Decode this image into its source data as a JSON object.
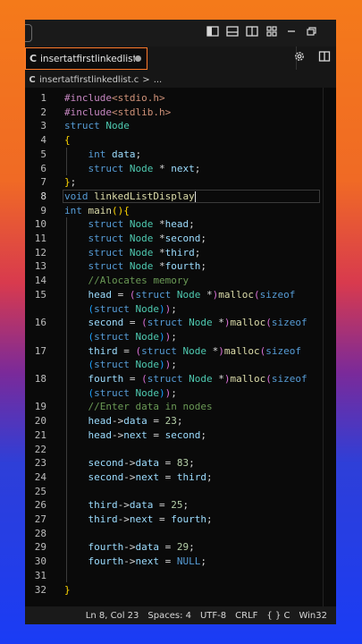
{
  "titlebar": {
    "icons": [
      "layout-sidebar-left-icon",
      "layout-panel-icon",
      "layout-sidebar-right-icon",
      "customize-layout-icon",
      "minimize-icon",
      "restore-icon"
    ]
  },
  "tab": {
    "icon": "C",
    "label": "insertatfirstlinkedlist.c",
    "dirty": true
  },
  "breadcrumb": {
    "icon": "C",
    "file": "insertatfirstlinkedlist.c",
    "sep": ">",
    "rest": "..."
  },
  "editor": {
    "active_line": 8,
    "lines": [
      {
        "n": "1",
        "tokens": [
          [
            "pp",
            "#include"
          ],
          [
            "inc",
            "<stdio.h>"
          ]
        ]
      },
      {
        "n": "2",
        "tokens": [
          [
            "pp",
            "#include"
          ],
          [
            "inc",
            "<stdlib.h>"
          ]
        ]
      },
      {
        "n": "3",
        "tokens": [
          [
            "kw",
            "struct"
          ],
          [
            "plain",
            " "
          ],
          [
            "type",
            "Node"
          ]
        ]
      },
      {
        "n": "4",
        "tokens": [
          [
            "br1",
            "{"
          ]
        ]
      },
      {
        "n": "5",
        "tokens": [
          [
            "plain",
            "    "
          ],
          [
            "kw",
            "int"
          ],
          [
            "plain",
            " "
          ],
          [
            "var",
            "data"
          ],
          [
            "plain",
            ";"
          ]
        ]
      },
      {
        "n": "6",
        "tokens": [
          [
            "plain",
            "    "
          ],
          [
            "kw",
            "struct"
          ],
          [
            "plain",
            " "
          ],
          [
            "type",
            "Node"
          ],
          [
            "plain",
            " * "
          ],
          [
            "var",
            "next"
          ],
          [
            "plain",
            ";"
          ]
        ]
      },
      {
        "n": "7",
        "tokens": [
          [
            "br1",
            "}"
          ],
          [
            "plain",
            ";"
          ]
        ]
      },
      {
        "n": "8",
        "tokens": [
          [
            "kw",
            "void"
          ],
          [
            "plain",
            " "
          ],
          [
            "fn",
            "linkedListDisplay"
          ]
        ]
      },
      {
        "n": "9",
        "tokens": [
          [
            "kw",
            "int"
          ],
          [
            "plain",
            " "
          ],
          [
            "fn",
            "main"
          ],
          [
            "br1",
            "()"
          ],
          [
            "br1",
            "{"
          ]
        ]
      },
      {
        "n": "10",
        "tokens": [
          [
            "plain",
            "    "
          ],
          [
            "kw",
            "struct"
          ],
          [
            "plain",
            " "
          ],
          [
            "type",
            "Node"
          ],
          [
            "plain",
            " *"
          ],
          [
            "var",
            "head"
          ],
          [
            "plain",
            ";"
          ]
        ]
      },
      {
        "n": "11",
        "tokens": [
          [
            "plain",
            "    "
          ],
          [
            "kw",
            "struct"
          ],
          [
            "plain",
            " "
          ],
          [
            "type",
            "Node"
          ],
          [
            "plain",
            " *"
          ],
          [
            "var",
            "second"
          ],
          [
            "plain",
            ";"
          ]
        ]
      },
      {
        "n": "12",
        "tokens": [
          [
            "plain",
            "    "
          ],
          [
            "kw",
            "struct"
          ],
          [
            "plain",
            " "
          ],
          [
            "type",
            "Node"
          ],
          [
            "plain",
            " *"
          ],
          [
            "var",
            "third"
          ],
          [
            "plain",
            ";"
          ]
        ]
      },
      {
        "n": "13",
        "tokens": [
          [
            "plain",
            "    "
          ],
          [
            "kw",
            "struct"
          ],
          [
            "plain",
            " "
          ],
          [
            "type",
            "Node"
          ],
          [
            "plain",
            " *"
          ],
          [
            "var",
            "fourth"
          ],
          [
            "plain",
            ";"
          ]
        ]
      },
      {
        "n": "14",
        "tokens": [
          [
            "plain",
            "    "
          ],
          [
            "com",
            "//Alocates memory"
          ]
        ]
      },
      {
        "n": "15",
        "tokens": [
          [
            "plain",
            "    "
          ],
          [
            "var",
            "head"
          ],
          [
            "plain",
            " = "
          ],
          [
            "br2",
            "("
          ],
          [
            "kw",
            "struct"
          ],
          [
            "plain",
            " "
          ],
          [
            "type",
            "Node"
          ],
          [
            "plain",
            " *"
          ],
          [
            "br2",
            ")"
          ],
          [
            "fn",
            "malloc"
          ],
          [
            "br2",
            "("
          ],
          [
            "kw",
            "sizeof"
          ]
        ]
      },
      {
        "n": "",
        "tokens": [
          [
            "plain",
            "    "
          ],
          [
            "br3",
            "("
          ],
          [
            "kw",
            "struct"
          ],
          [
            "plain",
            " "
          ],
          [
            "type",
            "Node"
          ],
          [
            "br3",
            ")"
          ],
          [
            "br2",
            ")"
          ],
          [
            "plain",
            ";"
          ]
        ]
      },
      {
        "n": "16",
        "tokens": [
          [
            "plain",
            "    "
          ],
          [
            "var",
            "second"
          ],
          [
            "plain",
            " = "
          ],
          [
            "br2",
            "("
          ],
          [
            "kw",
            "struct"
          ],
          [
            "plain",
            " "
          ],
          [
            "type",
            "Node"
          ],
          [
            "plain",
            " *"
          ],
          [
            "br2",
            ")"
          ],
          [
            "fn",
            "malloc"
          ],
          [
            "br2",
            "("
          ],
          [
            "kw",
            "sizeof"
          ]
        ]
      },
      {
        "n": "",
        "tokens": [
          [
            "plain",
            "    "
          ],
          [
            "br3",
            "("
          ],
          [
            "kw",
            "struct"
          ],
          [
            "plain",
            " "
          ],
          [
            "type",
            "Node"
          ],
          [
            "br3",
            ")"
          ],
          [
            "br2",
            ")"
          ],
          [
            "plain",
            ";"
          ]
        ]
      },
      {
        "n": "17",
        "tokens": [
          [
            "plain",
            "    "
          ],
          [
            "var",
            "third"
          ],
          [
            "plain",
            " = "
          ],
          [
            "br2",
            "("
          ],
          [
            "kw",
            "struct"
          ],
          [
            "plain",
            " "
          ],
          [
            "type",
            "Node"
          ],
          [
            "plain",
            " *"
          ],
          [
            "br2",
            ")"
          ],
          [
            "fn",
            "malloc"
          ],
          [
            "br2",
            "("
          ],
          [
            "kw",
            "sizeof"
          ]
        ]
      },
      {
        "n": "",
        "tokens": [
          [
            "plain",
            "    "
          ],
          [
            "br3",
            "("
          ],
          [
            "kw",
            "struct"
          ],
          [
            "plain",
            " "
          ],
          [
            "type",
            "Node"
          ],
          [
            "br3",
            ")"
          ],
          [
            "br2",
            ")"
          ],
          [
            "plain",
            ";"
          ]
        ]
      },
      {
        "n": "18",
        "tokens": [
          [
            "plain",
            "    "
          ],
          [
            "var",
            "fourth"
          ],
          [
            "plain",
            " = "
          ],
          [
            "br2",
            "("
          ],
          [
            "kw",
            "struct"
          ],
          [
            "plain",
            " "
          ],
          [
            "type",
            "Node"
          ],
          [
            "plain",
            " *"
          ],
          [
            "br2",
            ")"
          ],
          [
            "fn",
            "malloc"
          ],
          [
            "br2",
            "("
          ],
          [
            "kw",
            "sizeof"
          ]
        ]
      },
      {
        "n": "",
        "tokens": [
          [
            "plain",
            "    "
          ],
          [
            "br3",
            "("
          ],
          [
            "kw",
            "struct"
          ],
          [
            "plain",
            " "
          ],
          [
            "type",
            "Node"
          ],
          [
            "br3",
            ")"
          ],
          [
            "br2",
            ")"
          ],
          [
            "plain",
            ";"
          ]
        ]
      },
      {
        "n": "19",
        "tokens": [
          [
            "plain",
            "    "
          ],
          [
            "com",
            "//Enter data in nodes"
          ]
        ]
      },
      {
        "n": "20",
        "tokens": [
          [
            "plain",
            "    "
          ],
          [
            "var",
            "head"
          ],
          [
            "plain",
            "->"
          ],
          [
            "var",
            "data"
          ],
          [
            "plain",
            " = "
          ],
          [
            "num",
            "23"
          ],
          [
            "plain",
            ";"
          ]
        ]
      },
      {
        "n": "21",
        "tokens": [
          [
            "plain",
            "    "
          ],
          [
            "var",
            "head"
          ],
          [
            "plain",
            "->"
          ],
          [
            "var",
            "next"
          ],
          [
            "plain",
            " = "
          ],
          [
            "var",
            "second"
          ],
          [
            "plain",
            ";"
          ]
        ]
      },
      {
        "n": "22",
        "tokens": []
      },
      {
        "n": "23",
        "tokens": [
          [
            "plain",
            "    "
          ],
          [
            "var",
            "second"
          ],
          [
            "plain",
            "->"
          ],
          [
            "var",
            "data"
          ],
          [
            "plain",
            " = "
          ],
          [
            "num",
            "83"
          ],
          [
            "plain",
            ";"
          ]
        ]
      },
      {
        "n": "24",
        "tokens": [
          [
            "plain",
            "    "
          ],
          [
            "var",
            "second"
          ],
          [
            "plain",
            "->"
          ],
          [
            "var",
            "next"
          ],
          [
            "plain",
            " = "
          ],
          [
            "var",
            "third"
          ],
          [
            "plain",
            ";"
          ]
        ]
      },
      {
        "n": "25",
        "tokens": []
      },
      {
        "n": "26",
        "tokens": [
          [
            "plain",
            "    "
          ],
          [
            "var",
            "third"
          ],
          [
            "plain",
            "->"
          ],
          [
            "var",
            "data"
          ],
          [
            "plain",
            " = "
          ],
          [
            "num",
            "25"
          ],
          [
            "plain",
            ";"
          ]
        ]
      },
      {
        "n": "27",
        "tokens": [
          [
            "plain",
            "    "
          ],
          [
            "var",
            "third"
          ],
          [
            "plain",
            "->"
          ],
          [
            "var",
            "next"
          ],
          [
            "plain",
            " = "
          ],
          [
            "var",
            "fourth"
          ],
          [
            "plain",
            ";"
          ]
        ]
      },
      {
        "n": "28",
        "tokens": []
      },
      {
        "n": "29",
        "tokens": [
          [
            "plain",
            "    "
          ],
          [
            "var",
            "fourth"
          ],
          [
            "plain",
            "->"
          ],
          [
            "var",
            "data"
          ],
          [
            "plain",
            " = "
          ],
          [
            "num",
            "29"
          ],
          [
            "plain",
            ";"
          ]
        ]
      },
      {
        "n": "30",
        "tokens": [
          [
            "plain",
            "    "
          ],
          [
            "var",
            "fourth"
          ],
          [
            "plain",
            "->"
          ],
          [
            "var",
            "next"
          ],
          [
            "plain",
            " = "
          ],
          [
            "nl",
            "NULL"
          ],
          [
            "plain",
            ";"
          ]
        ]
      },
      {
        "n": "31",
        "tokens": []
      },
      {
        "n": "32",
        "tokens": [
          [
            "br1",
            "}"
          ]
        ]
      }
    ]
  },
  "statusbar": {
    "position": "Ln 8, Col 23",
    "spaces": "Spaces: 4",
    "encoding": "UTF-8",
    "eol": "CRLF",
    "language_icon": "{ }",
    "language": "C",
    "platform": "Win32"
  }
}
